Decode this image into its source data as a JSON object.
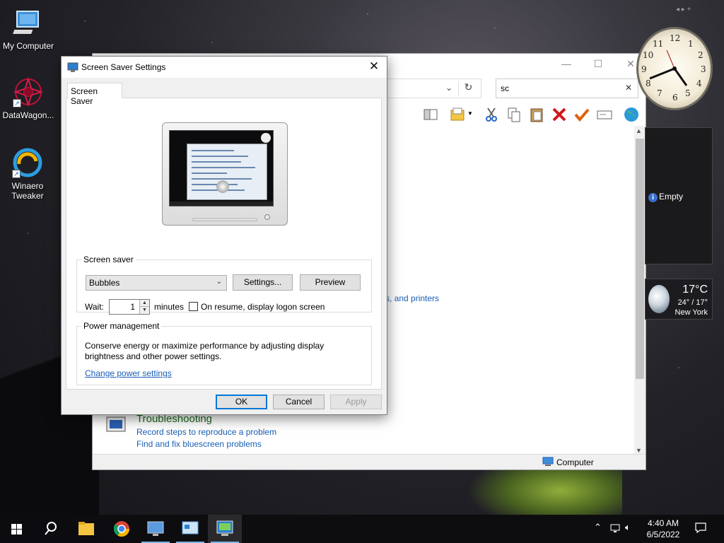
{
  "desktop": {
    "icons": [
      {
        "label": "My Computer"
      },
      {
        "label": "DataWagon..."
      },
      {
        "label": "Winaero Tweaker"
      }
    ]
  },
  "explorer": {
    "search_value": "sc",
    "status_computer": "Computer",
    "partial_link": "s, and printers",
    "troubleshooting": {
      "title": "Troubleshooting",
      "links": [
        "Record steps to reproduce a problem",
        "Find and fix bluescreen problems"
      ]
    }
  },
  "gadgets": {
    "clock_numbers": [
      "12",
      "1",
      "2",
      "3",
      "4",
      "5",
      "6",
      "7",
      "8",
      "9",
      "10",
      "11"
    ],
    "slideshow_text": "Empty",
    "weather": {
      "temp": "17°C",
      "range": "24° / 17°",
      "city": "New York"
    }
  },
  "dialog": {
    "title": "Screen Saver Settings",
    "tab": "Screen Saver",
    "screensaver_group": "Screen saver",
    "screensaver_selected": "Bubbles",
    "settings_button": "Settings...",
    "preview_button": "Preview",
    "wait_label": "Wait:",
    "wait_value": "1",
    "minutes_label": "minutes",
    "resume_label": "On resume, display logon screen",
    "resume_checked": false,
    "power_group": "Power management",
    "power_desc": "Conserve energy or maximize performance by adjusting display brightness and other power settings.",
    "power_link": "Change power settings",
    "ok": "OK",
    "cancel": "Cancel",
    "apply": "Apply"
  },
  "taskbar": {
    "time": "4:40 AM",
    "date": "6/5/2022",
    "accent": "#76b9ed"
  }
}
